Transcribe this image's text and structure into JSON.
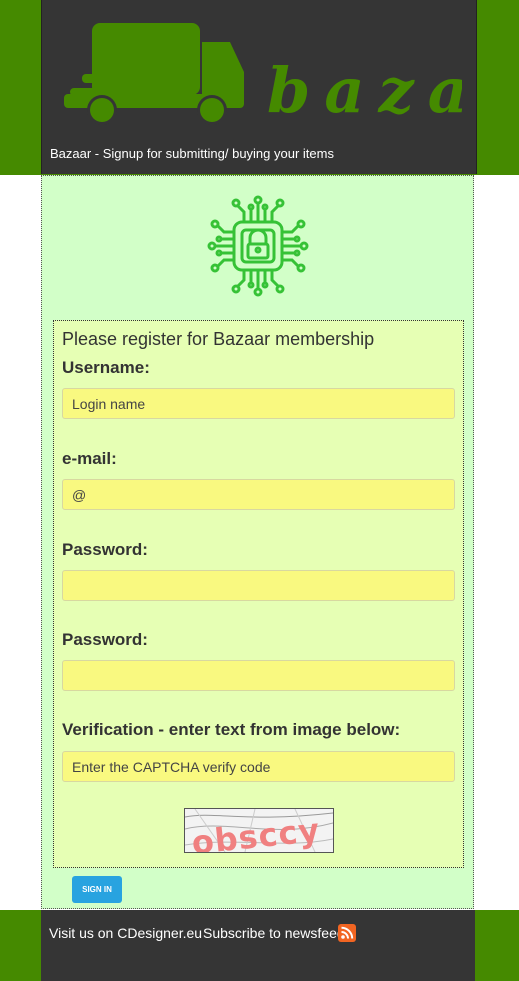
{
  "header": {
    "logo_text": "bazaar",
    "tagline": "Bazaar - Signup for submitting/ buying your items"
  },
  "form": {
    "title": "Please register for Bazaar membership",
    "username_label": "Username:",
    "username_placeholder": "Login name",
    "email_label": "e-mail:",
    "email_placeholder": "@",
    "password_label": "Password:",
    "password_confirm_label": "Password:",
    "verification_label": "Verification - enter text from image below:",
    "captcha_placeholder": "Enter the CAPTCHA verify code",
    "captcha_text": "obsccy",
    "signin_label": "SIGN IN"
  },
  "footer": {
    "visit_text": "Visit us on CDesigner.eu",
    "subscribe_text": "Subscribe to newsfeed"
  },
  "colors": {
    "accent_green": "#458a00",
    "dark_panel": "#353535",
    "form_bg": "#e6ffb4",
    "input_bg": "#f9f980",
    "button_blue": "#28a3e0"
  },
  "icons": {
    "logo": "delivery-truck-icon",
    "security": "chip-lock-icon",
    "feed": "rss-icon"
  }
}
